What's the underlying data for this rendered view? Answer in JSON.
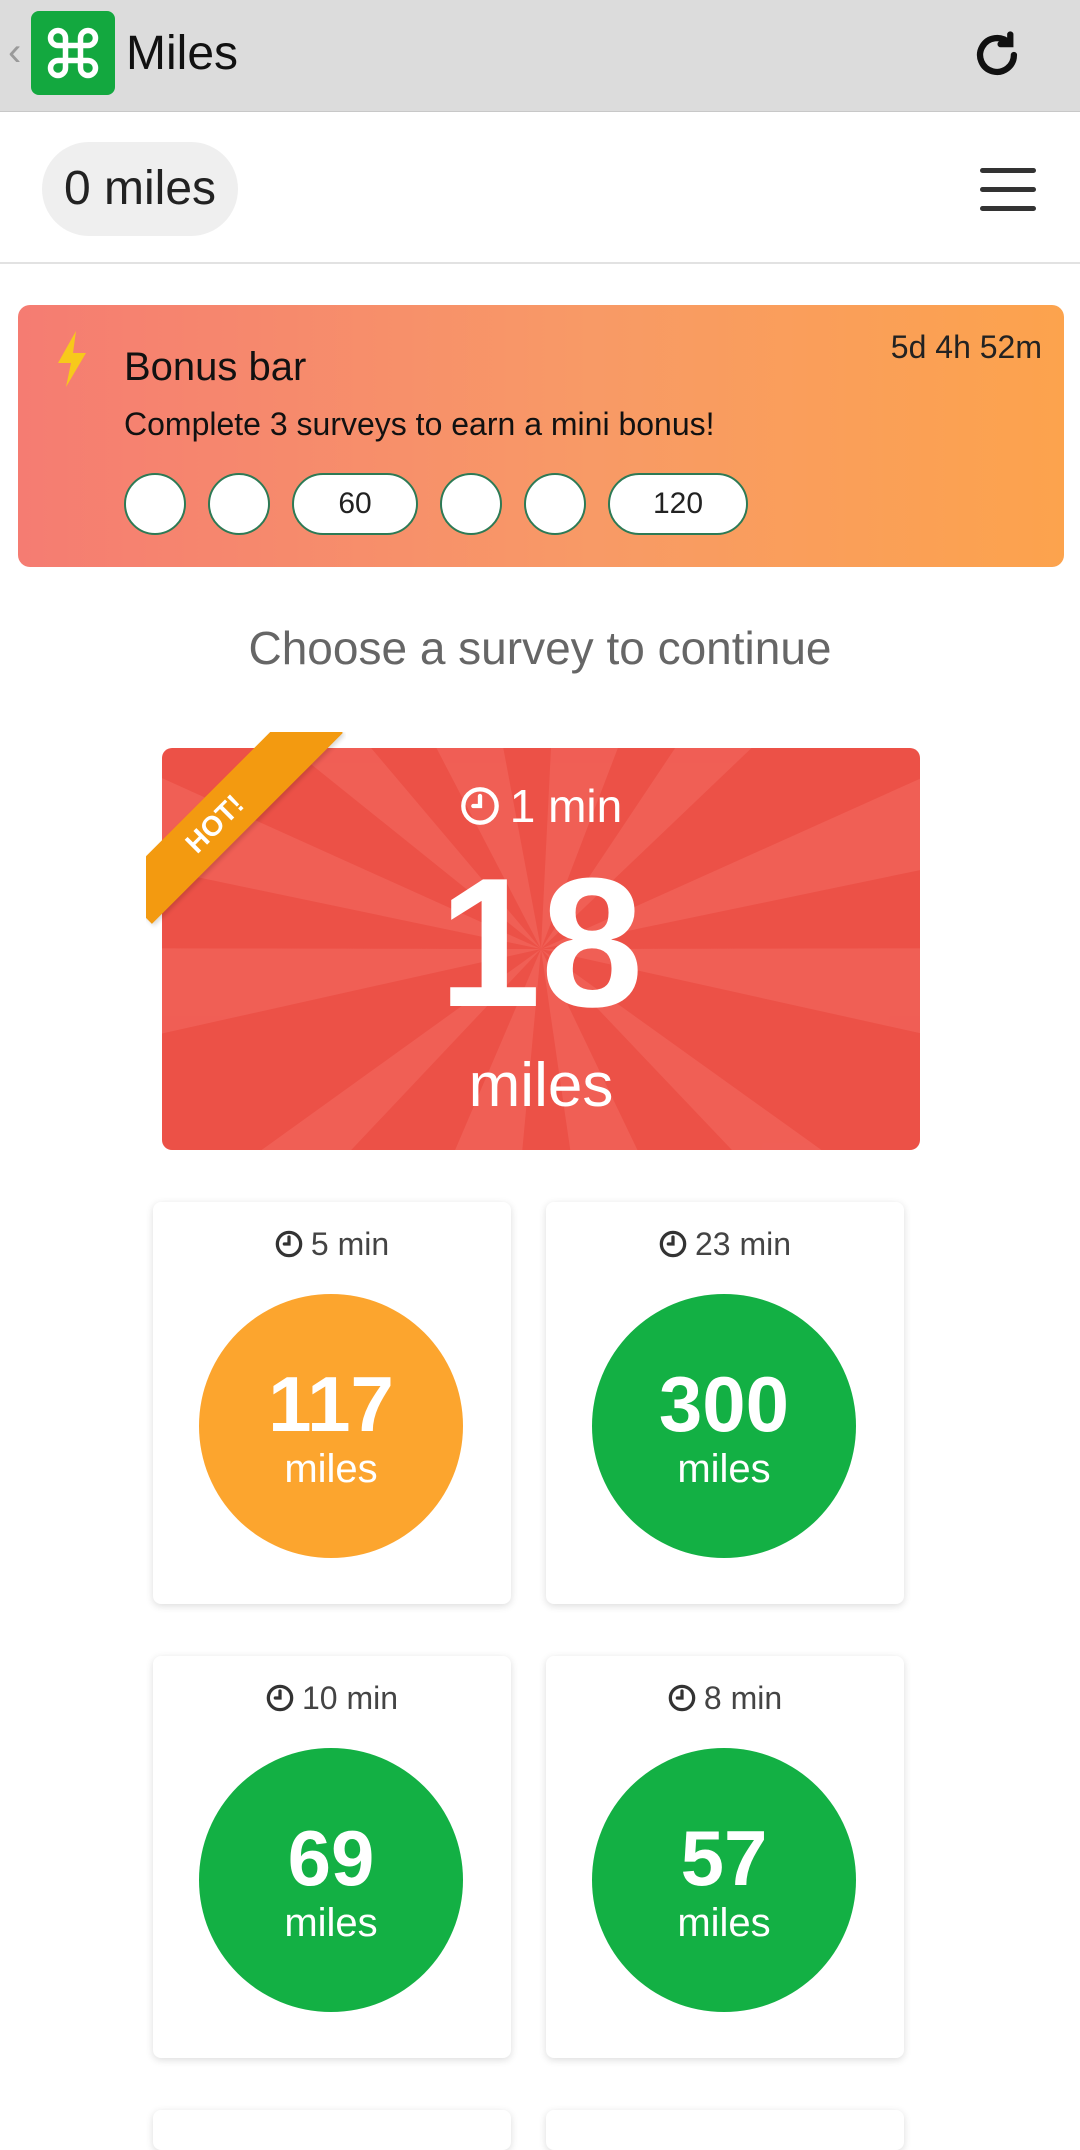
{
  "appbar": {
    "title": "Miles"
  },
  "header": {
    "balance": "0 miles"
  },
  "bonus": {
    "title": "Bonus bar",
    "timer": "5d 4h 52m",
    "description": "Complete 3 surveys to earn a mini bonus!",
    "steps": [
      "",
      "",
      "60",
      "",
      "",
      "120"
    ]
  },
  "prompt": "Choose a survey to continue",
  "hot": {
    "ribbon": "HOT!",
    "time": "1 min",
    "value": "18",
    "unit": "miles"
  },
  "surveys": [
    {
      "time": "5 min",
      "value": "117",
      "unit": "miles",
      "color": "#fca52e"
    },
    {
      "time": "23 min",
      "value": "300",
      "unit": "miles",
      "color": "#13b044"
    },
    {
      "time": "10 min",
      "value": "69",
      "unit": "miles",
      "color": "#13b044"
    },
    {
      "time": "8 min",
      "value": "57",
      "unit": "miles",
      "color": "#13b044"
    }
  ],
  "colors": {
    "brand": "#13a83f",
    "hot": "#ec5147",
    "ribbon": "#f39a10",
    "orange": "#fca52e",
    "green": "#13b044"
  },
  "icons": {
    "app": "command-icon",
    "refresh": "refresh-icon",
    "menu": "hamburger-menu-icon",
    "bolt": "lightning-bolt-icon",
    "clock": "clock-icon"
  }
}
